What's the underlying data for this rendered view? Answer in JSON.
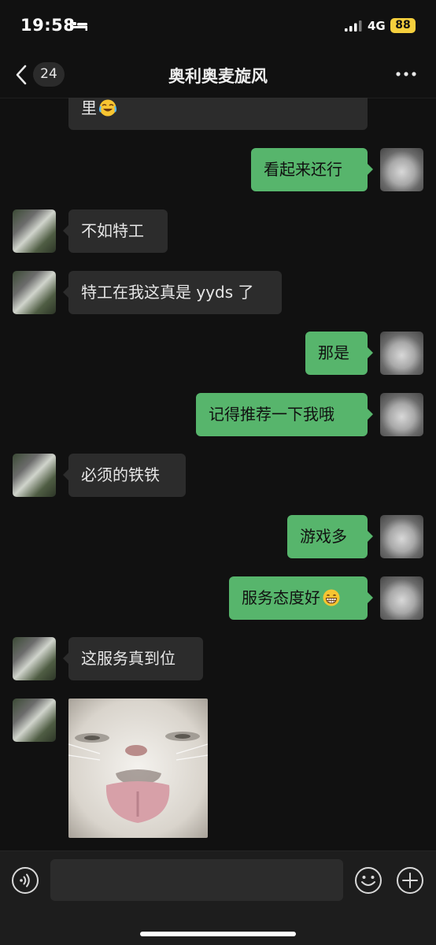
{
  "status_bar": {
    "time": "19:58",
    "network": "4G",
    "battery": "88",
    "icons": [
      "bed-icon",
      "signal-bars-icon"
    ]
  },
  "nav": {
    "unread_count": "24",
    "title": "奥利奥麦旋风",
    "icons": [
      "back-chevron-icon",
      "more-icon"
    ]
  },
  "messages": [
    {
      "from": "friend",
      "text": "里",
      "emoji": "crying-laughing-emoji",
      "partial": true
    },
    {
      "from": "me",
      "text": "看起来还行"
    },
    {
      "from": "friend",
      "text": "不如特工"
    },
    {
      "from": "friend",
      "text": "特工在我这真是 yyds 了"
    },
    {
      "from": "me",
      "text": "那是"
    },
    {
      "from": "me",
      "text": "记得推荐一下我哦"
    },
    {
      "from": "friend",
      "text": "必须的铁铁"
    },
    {
      "from": "me",
      "text": "游戏多"
    },
    {
      "from": "me",
      "text": "服务态度好",
      "emoji": "grinning-emoji"
    },
    {
      "from": "friend",
      "text": "这服务真到位"
    },
    {
      "from": "friend",
      "type": "image",
      "image": "cat-sticker"
    }
  ],
  "input_bar": {
    "value": "",
    "icons": [
      "voice-icon",
      "emoji-icon",
      "plus-icon"
    ]
  },
  "colors": {
    "background": "#111111",
    "incoming_bubble": "#2c2c2c",
    "outgoing_bubble": "#57b56c",
    "battery": "#f5cf3d"
  }
}
